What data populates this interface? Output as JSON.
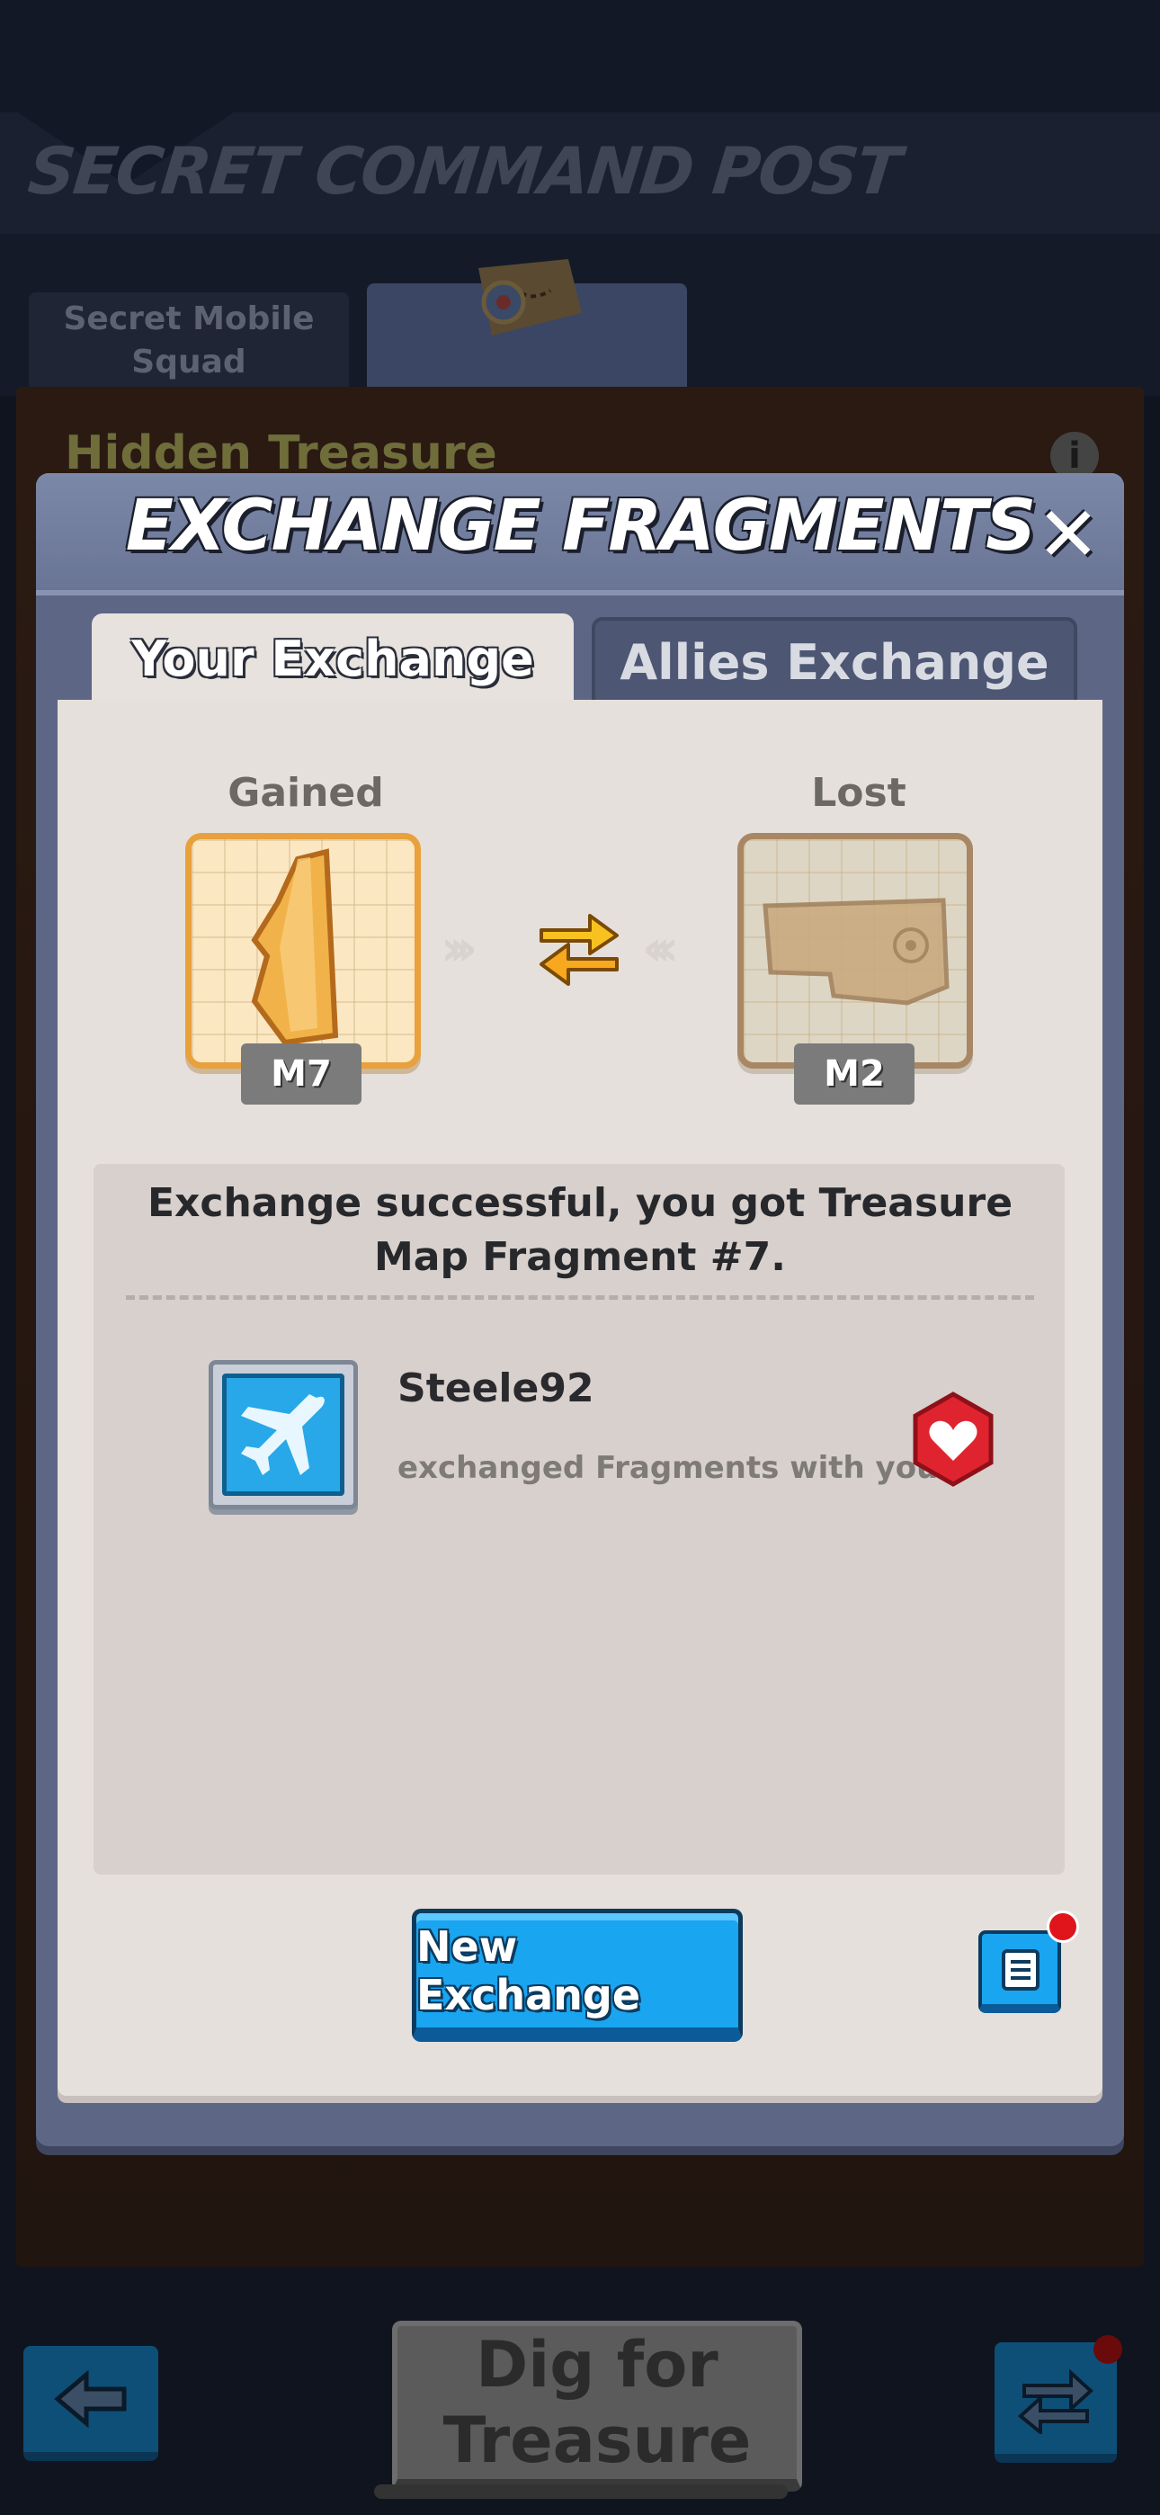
{
  "background": {
    "title": "SECRET COMMAND POST",
    "tab_left": "Secret Mobile Squad",
    "section_title": "Hidden Treasure",
    "info_icon": "i",
    "dig_button": "Dig for Treasure"
  },
  "modal": {
    "title": "EXCHANGE FRAGMENTS",
    "close_icon": "✕",
    "tabs": {
      "active": "Your Exchange",
      "inactive": "Allies Exchange"
    },
    "gained": {
      "label": "Gained",
      "tag": "M7"
    },
    "lost": {
      "label": "Lost",
      "tag": "M2"
    },
    "arrows_left": "›››",
    "arrows_right": "‹‹‹",
    "result_message": "Exchange successful, you got Treasure Map Fragment #7.",
    "player": {
      "name": "Steele92",
      "subtitle": "exchanged Fragments with you"
    },
    "new_exchange_button": "New Exchange"
  },
  "colors": {
    "accent_blue": "#1aa5f0",
    "modal_frame": "#5d6785",
    "notification_red": "#e0141b",
    "gained_border": "#e8a13c"
  }
}
